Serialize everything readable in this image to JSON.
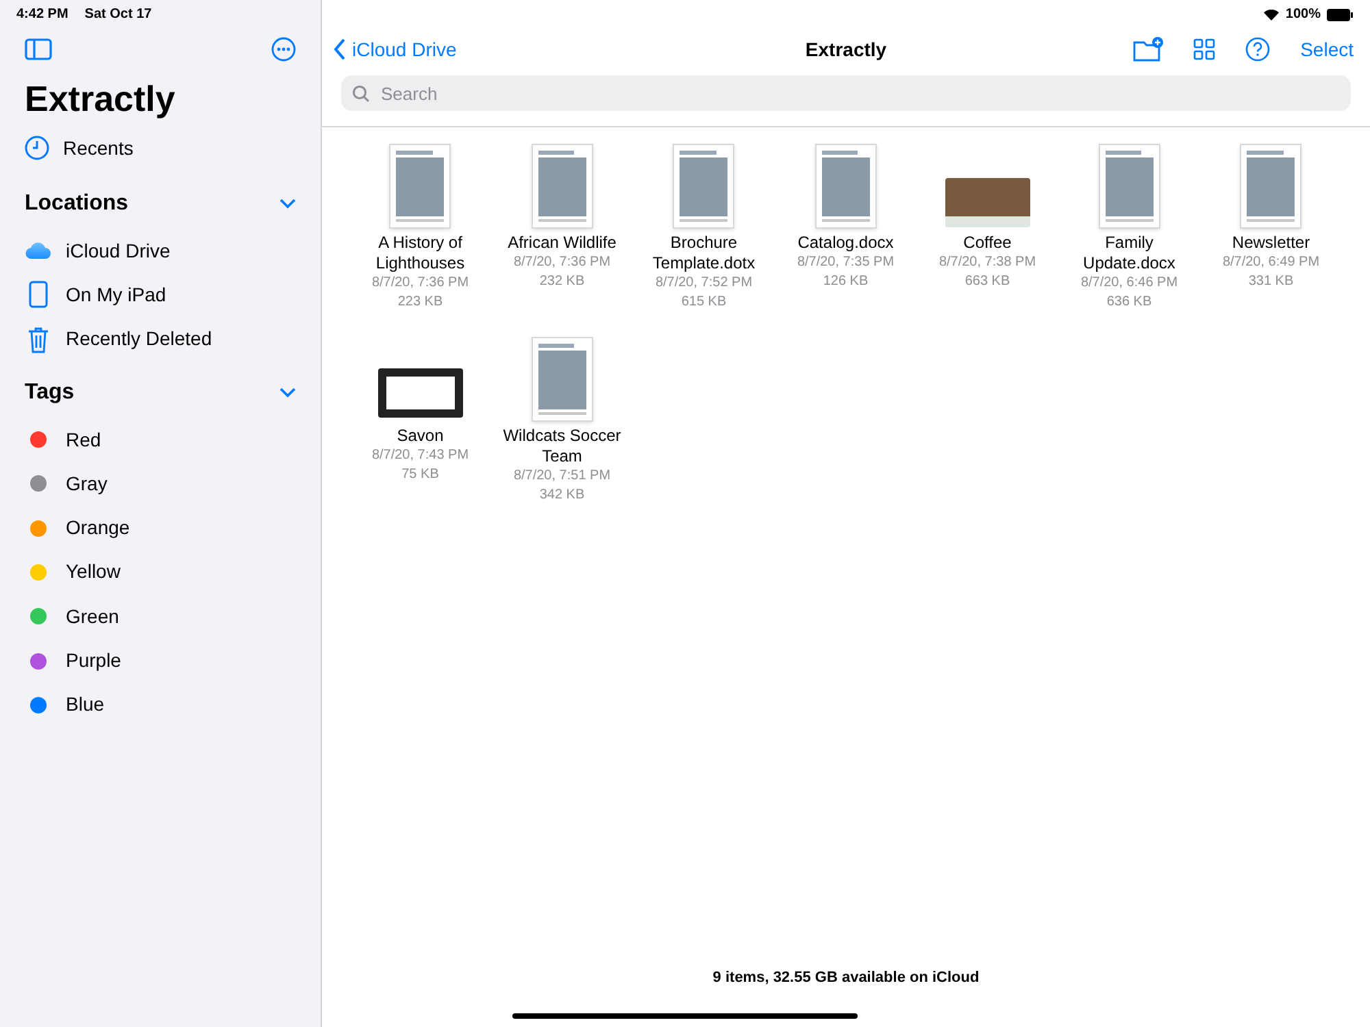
{
  "status_bar": {
    "time": "4:42 PM",
    "date": "Sat Oct 17",
    "battery": "100%"
  },
  "sidebar": {
    "title": "Extractly",
    "recents": "Recents",
    "sections": [
      {
        "title": "Locations",
        "expanded": true,
        "items": [
          {
            "label": "iCloud Drive",
            "kind": "icloud"
          },
          {
            "label": "On My iPad",
            "kind": "ipad"
          },
          {
            "label": "Recently Deleted",
            "kind": "trash"
          }
        ]
      },
      {
        "title": "Tags",
        "expanded": true,
        "items": [
          {
            "label": "Red",
            "kind": "tag",
            "color": "#ff3b30"
          },
          {
            "label": "Gray",
            "kind": "tag",
            "color": "#8e8e93"
          },
          {
            "label": "Orange",
            "kind": "tag",
            "color": "#ff9500"
          },
          {
            "label": "Yellow",
            "kind": "tag",
            "color": "#ffcc00"
          },
          {
            "label": "Green",
            "kind": "tag",
            "color": "#34c759"
          },
          {
            "label": "Purple",
            "kind": "tag",
            "color": "#af52de"
          },
          {
            "label": "Blue",
            "kind": "tag",
            "color": "#007aff"
          }
        ]
      }
    ]
  },
  "toolbar": {
    "back": "iCloud Drive",
    "title": "Extractly",
    "select": "Select"
  },
  "search": {
    "placeholder": "Search"
  },
  "files": [
    {
      "name": "A History of Lighthouses",
      "date": "8/7/20, 7:36 PM",
      "size": "223 KB",
      "kind": "page"
    },
    {
      "name": "African Wildlife",
      "date": "8/7/20, 7:36 PM",
      "size": "232 KB",
      "kind": "page"
    },
    {
      "name": "Brochure Template.dotx",
      "date": "8/7/20, 7:52 PM",
      "size": "615 KB",
      "kind": "page"
    },
    {
      "name": "Catalog.docx",
      "date": "8/7/20, 7:35 PM",
      "size": "126 KB",
      "kind": "page"
    },
    {
      "name": "Coffee",
      "date": "8/7/20, 7:38 PM",
      "size": "663 KB",
      "kind": "photo"
    },
    {
      "name": "Family Update.docx",
      "date": "8/7/20, 6:46 PM",
      "size": "636 KB",
      "kind": "page"
    },
    {
      "name": "Newsletter",
      "date": "8/7/20, 6:49 PM",
      "size": "331 KB",
      "kind": "page"
    },
    {
      "name": "Savon",
      "date": "8/7/20, 7:43 PM",
      "size": "75 KB",
      "kind": "frame"
    },
    {
      "name": "Wildcats Soccer Team",
      "date": "8/7/20, 7:51 PM",
      "size": "342 KB",
      "kind": "page"
    }
  ],
  "footer": "9 items, 32.55 GB available on iCloud"
}
